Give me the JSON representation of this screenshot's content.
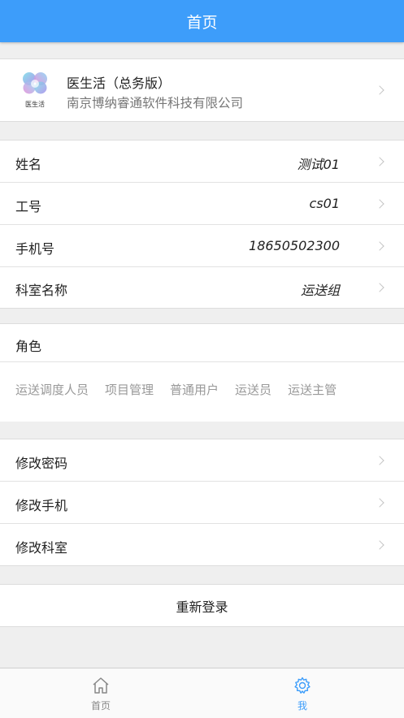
{
  "header": {
    "title": "首页"
  },
  "app": {
    "logo_text": "医生活",
    "name": "医生活（总务版）",
    "company": "南京博纳睿通软件科技有限公司"
  },
  "profile": {
    "rows": [
      {
        "label": "姓名",
        "value": "测试01"
      },
      {
        "label": "工号",
        "value": "cs01"
      },
      {
        "label": "手机号",
        "value": "18650502300"
      },
      {
        "label": "科室名称",
        "value": "运送组"
      }
    ]
  },
  "roles": {
    "title": "角色",
    "tags": [
      "运送调度人员",
      "项目管理",
      "普通用户",
      "运送员",
      "运送主管"
    ]
  },
  "actions": [
    {
      "label": "修改密码"
    },
    {
      "label": "修改手机"
    },
    {
      "label": "修改科室"
    }
  ],
  "logout": {
    "label": "重新登录"
  },
  "tabbar": {
    "items": [
      {
        "label": "首页",
        "icon": "home-icon"
      },
      {
        "label": "我",
        "icon": "gear-icon"
      }
    ],
    "active_color": "#3d9dfa"
  },
  "colors": {
    "header": "#3d9dfa",
    "background": "#efefef"
  }
}
